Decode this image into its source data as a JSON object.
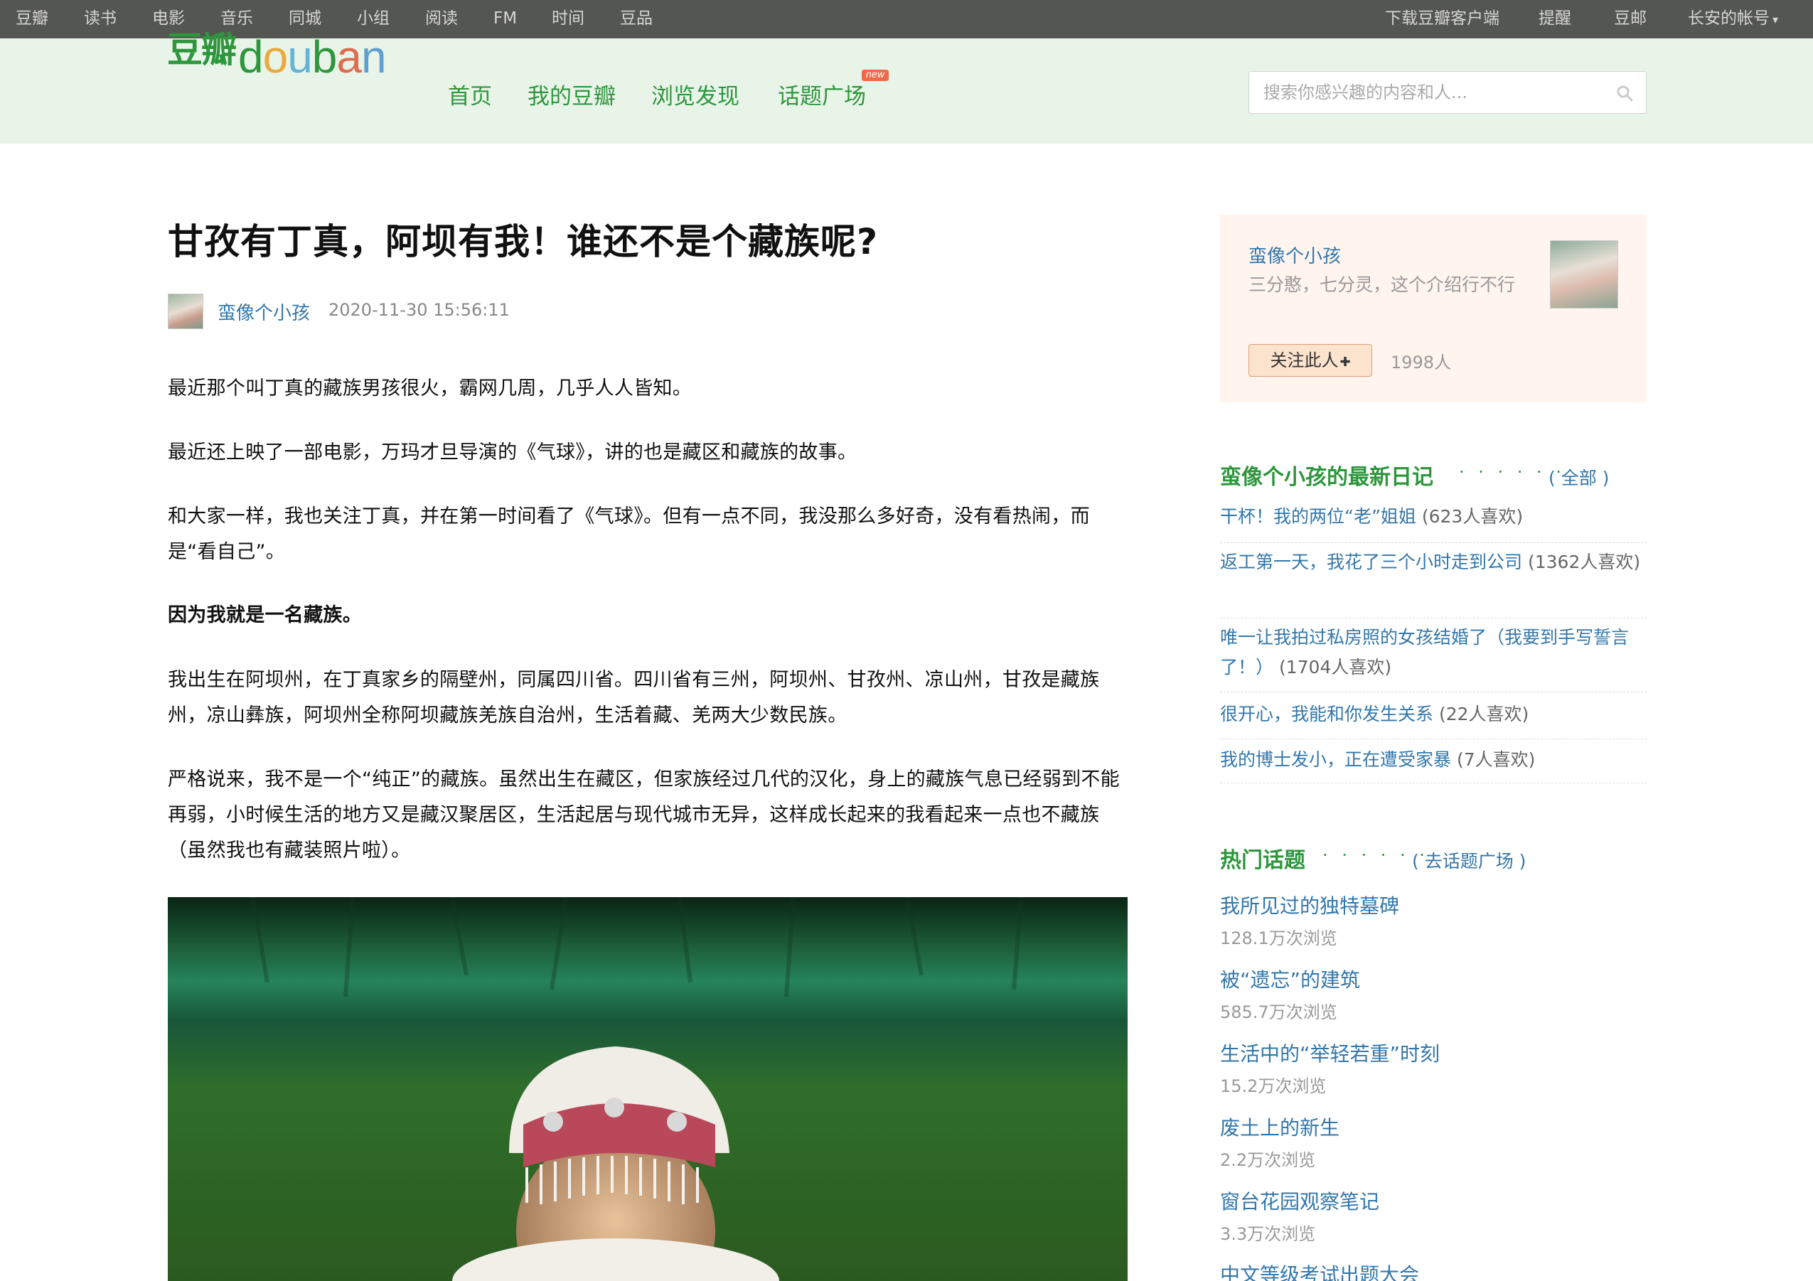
{
  "global_nav": {
    "left_items": [
      "豆瓣",
      "读书",
      "电影",
      "音乐",
      "同城",
      "小组",
      "阅读",
      "FM",
      "时间",
      "豆品"
    ],
    "right_items": [
      "下载豆瓣客户端",
      "提醒",
      "豆邮",
      "长安的帐号"
    ],
    "account_arrow": "▾"
  },
  "header": {
    "logo_cn": "豆瓣",
    "logo_en_letters": [
      "d",
      "o",
      "u",
      "b",
      "a",
      "n"
    ],
    "nav": [
      "首页",
      "我的豆瓣",
      "浏览发现",
      "话题广场"
    ],
    "new_badge": "new",
    "search_placeholder": "搜索你感兴趣的内容和人..."
  },
  "article": {
    "title": "甘孜有丁真，阿坝有我！谁还不是个藏族呢?",
    "author": "蛮像个小孩",
    "time": "2020-11-30 15:56:11",
    "paragraphs": [
      " 最近那个叫丁真的藏族男孩很火，霸网几周，几乎人人皆知。",
      "最近还上映了一部电影，万玛才旦导演的《气球》，讲的也是藏区和藏族的故事。",
      "和大家一样，我也关注丁真，并在第一时间看了《气球》。但有一点不同，我没那么多好奇，没有看热闹，而是“看自己”。",
      "因为我就是一名藏族。",
      "我出生在阿坝州，在丁真家乡的隔壁州，同属四川省。四川省有三州，阿坝州、甘孜州、凉山州，甘孜是藏族州，凉山彝族，阿坝州全称阿坝藏族羌族自治州，生活着藏、羌两大少数民族。",
      "严格说来，我不是一个“纯正”的藏族。虽然出生在藏区，但家族经过几代的汉化，身上的藏族气息已经弱到不能再弱，小时候生活的地方又是藏汉聚居区，生活起居与现代城市无异，这样成长起来的我看起来一点也不藏族（虽然我也有藏装照片啦）。"
    ]
  },
  "sidebar": {
    "profile": {
      "name": "蛮像个小孩",
      "intro": "三分憨，七分灵，这个介绍行不行",
      "follow_label": "关注此人",
      "follow_plus": "✚",
      "followers": "1998人"
    },
    "diary": {
      "title": "蛮像个小孩的最新日记",
      "dots": "· · · · · ·",
      "all_link": "( 全部 )",
      "items": [
        {
          "title": "干杯！我的两位“老”姐姐",
          "likes": "(623人喜欢)"
        },
        {
          "title": "返工第一天，我花了三个小时走到公司",
          "likes": "(1362人喜欢)"
        },
        {
          "title": "唯一让我拍过私房照的女孩结婚了（我要到手写誓言了！）",
          "likes": "(1704人喜欢)"
        },
        {
          "title": "很开心，我能和你发生关系",
          "likes": "(22人喜欢)"
        },
        {
          "title": "我的博士发小，正在遭受家暴",
          "likes": "(7人喜欢)"
        }
      ]
    },
    "topics": {
      "title": "热门话题",
      "dots": "· · · · · ·",
      "link": "( 去话题广场 )",
      "items": [
        {
          "title": "我所见过的独特墓碑",
          "views": "128.1万次浏览"
        },
        {
          "title": "被“遗忘”的建筑",
          "views": "585.7万次浏览"
        },
        {
          "title": "生活中的“举轻若重”时刻",
          "views": "15.2万次浏览"
        },
        {
          "title": "废土上的新生",
          "views": "2.2万次浏览"
        },
        {
          "title": "窗台花园观察笔记",
          "views": "3.3万次浏览"
        },
        {
          "title": "中文等级考试出题大会",
          "views": ""
        }
      ]
    }
  }
}
